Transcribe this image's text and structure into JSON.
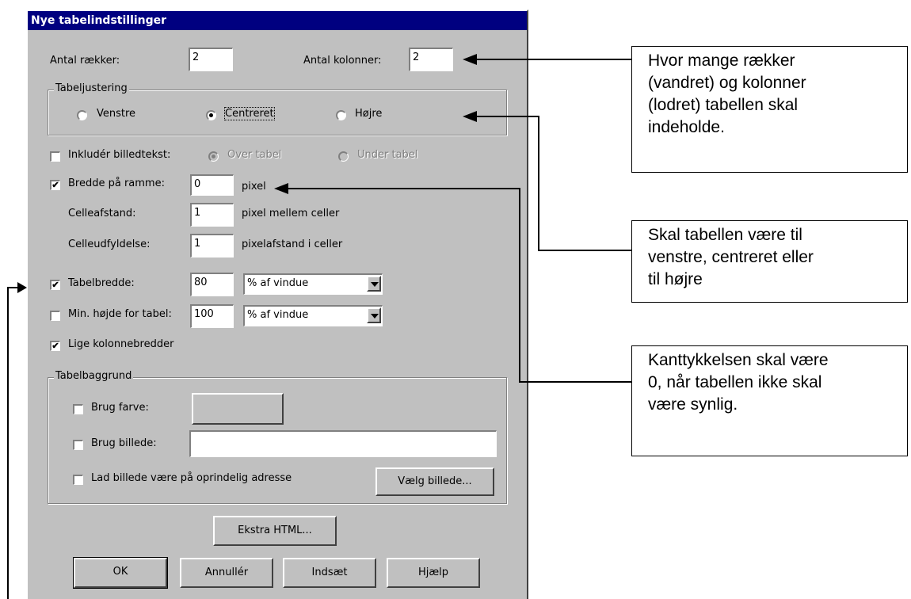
{
  "dialog": {
    "title": "Nye tabelindstillinger",
    "rows_label": "Antal rækker:",
    "rows_value": "2",
    "cols_label": "Antal kolonner:",
    "cols_value": "2",
    "alignment": {
      "group_label": "Tabeljustering",
      "left_label": "Venstre",
      "center_label": "Centreret",
      "right_label": "Højre",
      "selected": "center"
    },
    "caption": {
      "label": "Inkludér billedtekst:",
      "checked": false,
      "above_label": "Over tabel",
      "below_label": "Under tabel"
    },
    "border": {
      "label": "Bredde på ramme:",
      "checked": true,
      "value": "0",
      "unit": "pixel"
    },
    "spacing": {
      "label": "Celleafstand:",
      "value": "1",
      "unit": "pixel mellem celler"
    },
    "padding": {
      "label": "Celleudfyldelse:",
      "value": "1",
      "unit": "pixelafstand i celler"
    },
    "table_width": {
      "label": "Tabelbredde:",
      "checked": true,
      "value": "80",
      "unit_option": "% af vindue"
    },
    "min_height": {
      "label": "Min. højde for tabel:",
      "checked": false,
      "value": "100",
      "unit_option": "% af vindue"
    },
    "equal_columns": {
      "label": "Lige kolonnebredder",
      "checked": true
    },
    "background": {
      "group_label": "Tabelbaggrund",
      "use_color_label": "Brug farve:",
      "use_image_label": "Brug billede:",
      "image_value": "",
      "keep_original_label": "Lad billede være på oprindelig adresse",
      "choose_image_button": "Vælg billede..."
    },
    "extra_html_button": "Ekstra HTML...",
    "ok_button": "OK",
    "cancel_button": "Annullér",
    "insert_button": "Indsæt",
    "help_button": "Hjælp"
  },
  "callouts": {
    "rows_cols": [
      "Hvor mange rækker",
      "(vandret) og kolonner",
      "(lodret) tabellen skal",
      "indeholde."
    ],
    "alignment": [
      "Skal tabellen være til",
      "venstre, centreret eller",
      "til højre"
    ],
    "border": [
      "Kanttykkelsen skal være",
      "0, når tabellen ikke skal",
      "være synlig."
    ]
  },
  "colors": {
    "dialog_bg": "#c0c0c0",
    "titlebar": "#000080",
    "check_mark": "✔"
  }
}
